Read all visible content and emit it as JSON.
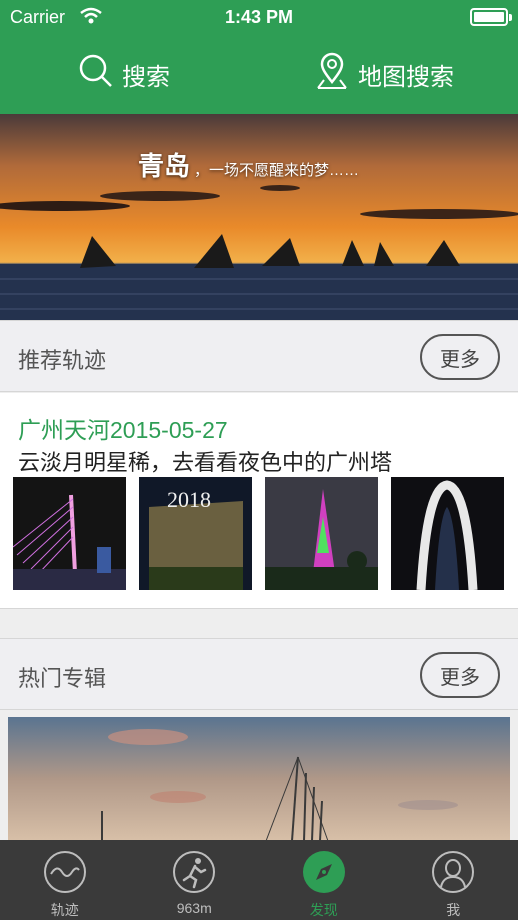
{
  "status": {
    "carrier": "Carrier",
    "time": "1:43 PM"
  },
  "search": {
    "left_label": "搜索",
    "right_label": "地图搜索"
  },
  "banner": {
    "city": "青岛",
    "subtitle": "，一场不愿醒来的梦……"
  },
  "recommended": {
    "title": "推荐轨迹",
    "more": "更多"
  },
  "track": {
    "title": "广州天河2015-05-27",
    "description": "云淡月明星稀，去看看夜色中的广州塔",
    "photos": [
      "bridge-photo",
      "sign-2018-photo",
      "canton-tower-photo",
      "arch-photo"
    ]
  },
  "albums": {
    "title": "热门专辑",
    "more": "更多"
  },
  "tabs": [
    {
      "label": "轨迹",
      "icon": "wave-icon"
    },
    {
      "label": "963m",
      "icon": "run-icon"
    },
    {
      "label": "发现",
      "icon": "compass-icon"
    },
    {
      "label": "我",
      "icon": "person-icon"
    }
  ],
  "colors": {
    "accent": "#2e9e55",
    "tabbar": "#3a3a3a",
    "section_bg": "#efeff2"
  }
}
